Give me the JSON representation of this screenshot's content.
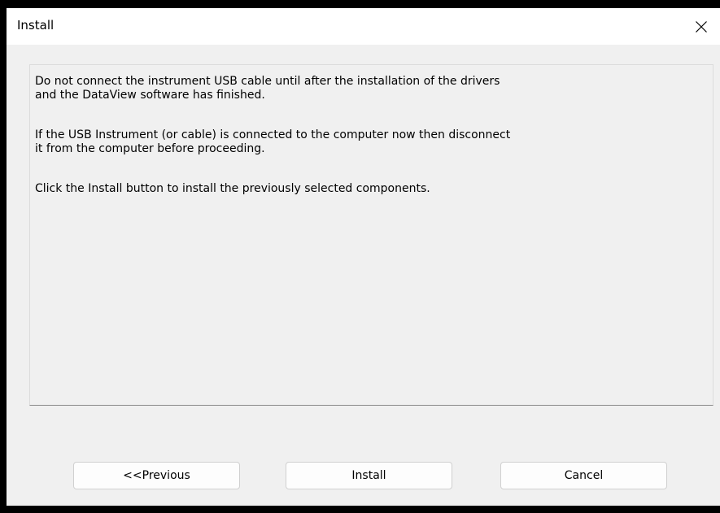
{
  "window": {
    "title": "Install"
  },
  "icons": {
    "close": "close-icon"
  },
  "content": {
    "paragraph1_line1": "Do not connect the instrument USB cable until after the installation of the drivers",
    "paragraph1_line2": "and the DataView software has finished.",
    "paragraph2_line1": "If the USB Instrument (or cable) is connected to the computer now then disconnect",
    "paragraph2_line2": "it from the computer before proceeding.",
    "paragraph3": "Click the Install button to install the previously selected components."
  },
  "buttons": {
    "previous_label": "<<Previous",
    "install_label": "Install",
    "cancel_label": "Cancel"
  },
  "colors": {
    "dialog_background": "#f0f0f0",
    "titlebar_background": "#ffffff",
    "button_background": "#fdfdfd"
  }
}
